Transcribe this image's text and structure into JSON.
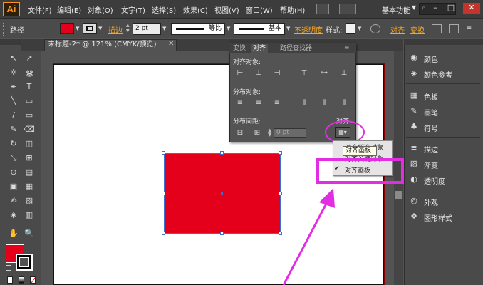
{
  "app": {
    "logo": "Ai"
  },
  "menu": [
    "文件(F)",
    "编辑(E)",
    "对象(O)",
    "文字(T)",
    "选择(S)",
    "效果(C)",
    "视图(V)",
    "窗口(W)",
    "帮助(H)"
  ],
  "workspace": {
    "label": "基本功能",
    "arrow": "▼"
  },
  "window_controls": {
    "minimize": "–",
    "maximize": "□",
    "close": "✕"
  },
  "control_bar": {
    "object_label": "路径",
    "fill_color": "#e4001b",
    "stroke_link": "描边",
    "stroke_weight": "2 pt",
    "profile_1": "等比",
    "profile_2": "基本",
    "opacity_link": "不透明度",
    "style_label": "样式:",
    "align_link": "对齐",
    "transform_link": "变换"
  },
  "document_tab": {
    "title": "未标题-2* @ 121% (CMYK/预览)",
    "close": "✕"
  },
  "align_panel": {
    "tabs": [
      "变换",
      "对齐",
      "路径查找器"
    ],
    "menu_icon": "≡",
    "align_objects": "对齐对象:",
    "distribute_objects": "分布对象:",
    "distribute_spacing": "分布间距:",
    "align_to": "对齐:",
    "spacing_value": "0 pt"
  },
  "dropdown": {
    "option_selection": "对齐所选对象",
    "option_key": "对齐关键对象",
    "option_artboard": "对齐画板",
    "tooltip": "对齐画板",
    "checkmark": "✔"
  },
  "dock": {
    "items": [
      {
        "label": "颜色",
        "icon": "◉"
      },
      {
        "label": "颜色参考",
        "icon": "◈"
      },
      {
        "label": "色板",
        "icon": "▦"
      },
      {
        "label": "画笔",
        "icon": "✎"
      },
      {
        "label": "符号",
        "icon": "♣"
      },
      {
        "label": "描边",
        "icon": "≡"
      },
      {
        "label": "渐变",
        "icon": "▧"
      },
      {
        "label": "透明度",
        "icon": "◐"
      },
      {
        "label": "外观",
        "icon": "◎"
      },
      {
        "label": "图形样式",
        "icon": "❖"
      }
    ]
  },
  "colors": {
    "accent_magenta": "#e22ee2",
    "shape_fill": "#e4001b",
    "link_orange": "#f5a623"
  },
  "tools": [
    "↖",
    "↗",
    "✲",
    "ൠ",
    "✒",
    "T",
    "╲",
    "▭",
    "∕",
    "▭",
    "✎",
    "⌫",
    "↻",
    "◫",
    "⤡",
    "⊞",
    "⊙",
    "▤",
    "▣",
    "▦",
    "✍",
    "▨",
    "◈",
    "▥",
    "✋",
    "🔍"
  ]
}
